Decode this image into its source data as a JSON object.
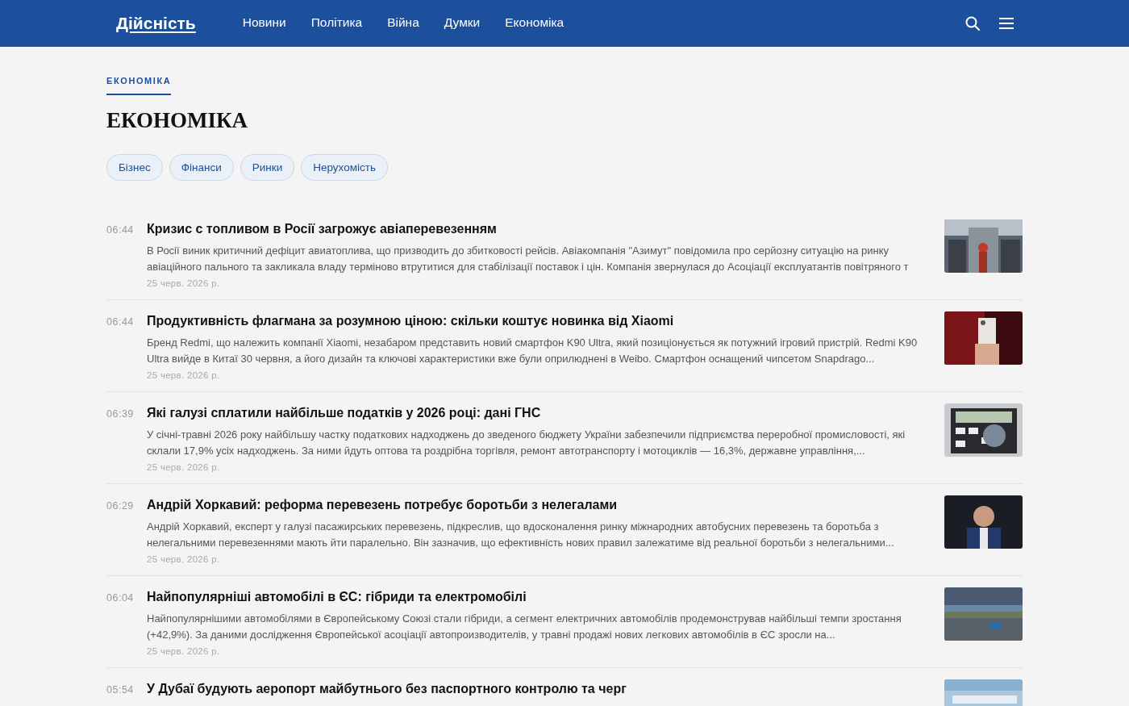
{
  "header": {
    "logo": "Дійсність",
    "nav": [
      {
        "label": "Новини",
        "selected": false
      },
      {
        "label": "Політика",
        "selected": false
      },
      {
        "label": "Війна",
        "selected": false
      },
      {
        "label": "Думки",
        "selected": false
      },
      {
        "label": "Економіка",
        "selected": false
      }
    ]
  },
  "breadcrumb": "ЕКОНОМІКА",
  "title": "ЕКОНОМІКА",
  "tags": [
    "Бізнес",
    "Фінанси",
    "Ринки",
    "Нерухомість"
  ],
  "articles": [
    {
      "time": "06:44",
      "headline": "Кризис с топливом в Росії загрожує авіаперевезенням",
      "summary": "В Росії виник критичний дефіцит авиатоплива, що призводить до збитковості рейсів. Авіакомпанія \"Азимут\" повідомила про серйозну ситуацію на ринку авіаційного пального та закликала владу терміново втрутитися для стабілізації поставок і цін. Компанія звернулася до Асоціації експлуатантів повітряного т",
      "date": "25 черв. 2026 р."
    },
    {
      "time": "06:44",
      "headline": "Продуктивність флагмана за розумною ціною: скільки коштує новинка від Xiaomi",
      "summary": "Бренд Redmi, що належить компанії Xiaomi, незабаром представить новий смартфон K90 Ultra, який позиціонується як потужний ігровий пристрій. Redmi K90 Ultra вийде в Китаї 30 червня, а його дизайн та ключові характеристики вже були оприлюднені в Weibo. Смартфон оснащений чипсетом Snapdrago...",
      "date": "25 черв. 2026 р."
    },
    {
      "time": "06:39",
      "headline": "Які галузі сплатили найбільше податків у 2026 році: дані ГНС",
      "summary": "У січні-травні 2026 року найбільшу частку податкових надходжень до зведеного бюджету України забезпечили підприємства переробної промисловості, які склали 17,9% усіх надходжень. За ними йдуть оптова та роздрібна торгівля, ремонт автотранспорту і мотоциклів — 16,3%, державне управління,...",
      "date": "25 черв. 2026 р."
    },
    {
      "time": "06:29",
      "headline": "Андрій Хоркавий: реформа перевезень потребує боротьби з нелегалами",
      "summary": "Андрій Хоркавий, експерт у галузі пасажирських перевезень, підкреслив, що вдосконалення ринку міжнародних автобусних перевезень та боротьба з нелегальними перевезеннями мають йти паралельно. Він зазначив, що ефективність нових правил залежатиме від реальної боротьби з нелегальними...",
      "date": "25 черв. 2026 р."
    },
    {
      "time": "06:04",
      "headline": "Найпопулярніші автомобілі в ЄС: гібриди та електромобілі",
      "summary": "Найпопулярнішими автомобілями в Європейському Союзі стали гібриди, а сегмент електричних автомобілів продемонстрував найбільші темпи зростання (+42,9%). За даними дослідження Європейської асоціації автопроизводителів, у травні продажі нових легкових автомобілів в ЄС зросли на...",
      "date": "25 черв. 2026 р."
    },
    {
      "time": "05:54",
      "headline": "У Дубаї будують аеропорт майбутнього без паспортного контролю та черг"
    }
  ]
}
